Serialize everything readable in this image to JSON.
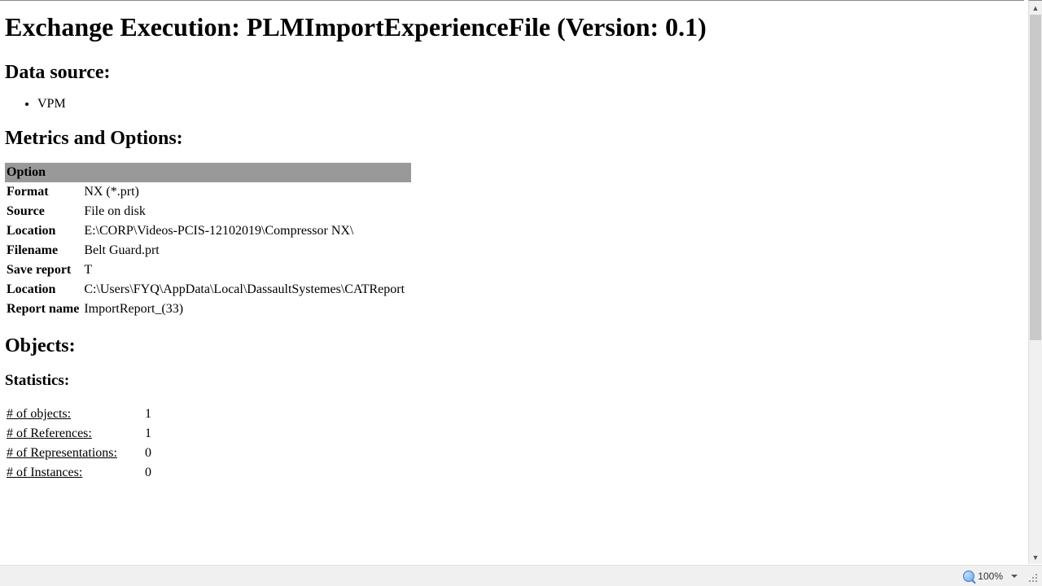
{
  "title": "Exchange Execution: PLMImportExperienceFile (Version: 0.1)",
  "sections": {
    "data_source": {
      "heading": "Data source:",
      "items": [
        "VPM"
      ]
    },
    "metrics": {
      "heading": "Metrics and Options:",
      "option_header": "Option",
      "rows": [
        {
          "label": "Format",
          "value": "NX (*.prt)"
        },
        {
          "label": "Source",
          "value": "File on disk"
        },
        {
          "label": "Location",
          "value": "E:\\CORP\\Videos-PCIS-12102019\\Compressor NX\\"
        },
        {
          "label": "Filename",
          "value": "Belt Guard.prt"
        },
        {
          "label": "Save report",
          "value": "T"
        },
        {
          "label": "Location",
          "value": "C:\\Users\\FYQ\\AppData\\Local\\DassaultSystemes\\CATReport"
        },
        {
          "label": "Report name",
          "value": "ImportReport_(33)"
        }
      ]
    },
    "objects": {
      "heading": "Objects:",
      "stats_heading": "Statistics:",
      "stats": [
        {
          "label": "# of objects:",
          "value": "1"
        },
        {
          "label": "# of References:",
          "value": "1"
        },
        {
          "label": "# of Representations:",
          "value": "0"
        },
        {
          "label": "# of Instances:",
          "value": "0"
        }
      ]
    }
  },
  "statusbar": {
    "zoom": "100%"
  }
}
